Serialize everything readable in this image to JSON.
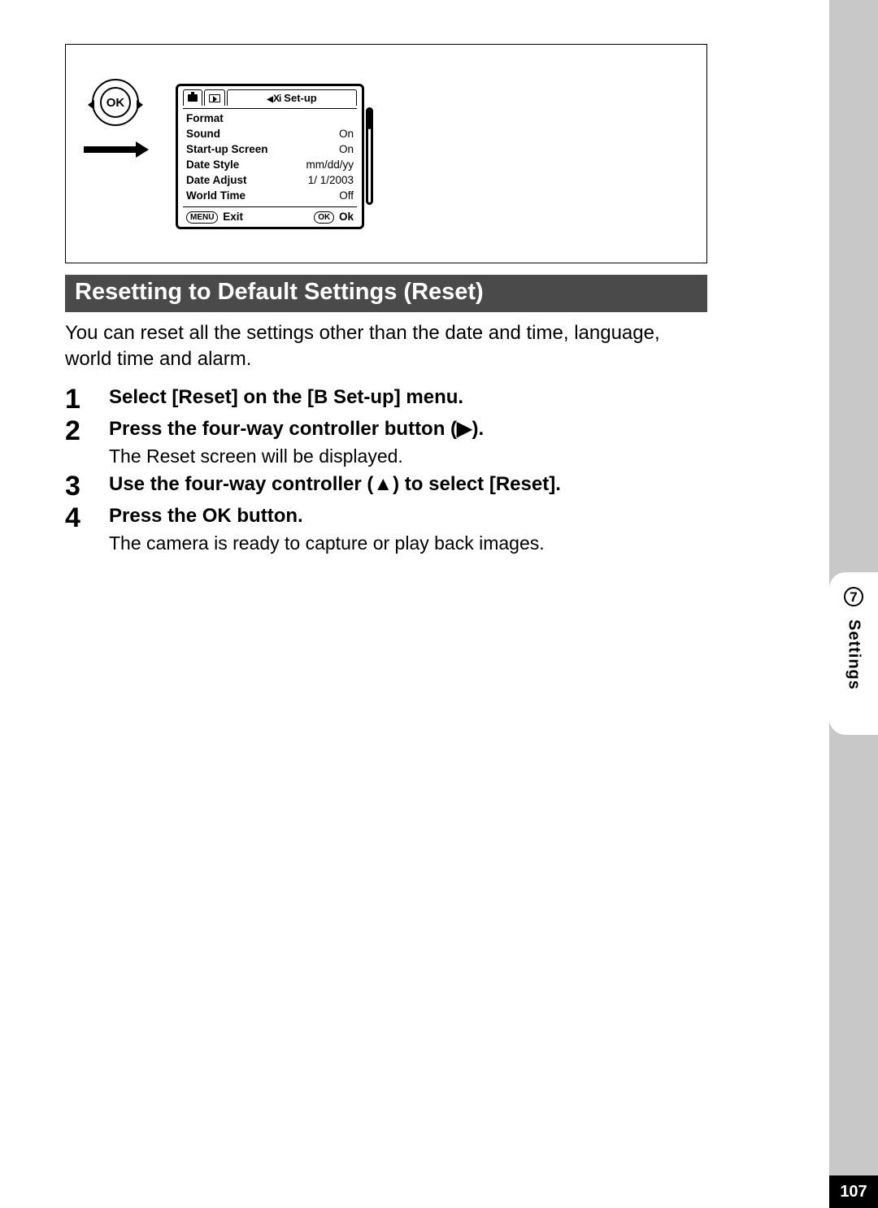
{
  "dial": {
    "label": "OK"
  },
  "lcd": {
    "active_tab_label": "Set-up",
    "tools_glyph": "Xi",
    "menu": [
      {
        "k": "Format",
        "v": ""
      },
      {
        "k": "Sound",
        "v": "On"
      },
      {
        "k": "Start-up Screen",
        "v": "On"
      },
      {
        "k": "Date Style",
        "v": "mm/dd/yy"
      },
      {
        "k": "Date Adjust",
        "v": "1/ 1/2003"
      },
      {
        "k": "World Time",
        "v": "Off"
      }
    ],
    "footer": {
      "left_btn": "MENU",
      "left_label": "Exit",
      "right_btn": "OK",
      "right_label": "Ok"
    }
  },
  "heading": "Resetting to Default Settings (Reset)",
  "intro": "You can reset all the settings other than the date and time, language, world time and alarm.",
  "steps": [
    {
      "num": "1",
      "title_pre": "Select [Reset] on the [",
      "title_icon": "B",
      "title_post": " Set-up] menu."
    },
    {
      "num": "2",
      "title": "Press the four-way controller button (▶).",
      "desc": "The Reset screen will be displayed."
    },
    {
      "num": "3",
      "title": "Use the four-way controller (▲) to select [Reset]."
    },
    {
      "num": "4",
      "title": "Press the OK button.",
      "desc": "The camera is ready to capture or play back images."
    }
  ],
  "side": {
    "chapter_num": "7",
    "label": "Settings"
  },
  "page_number": "107"
}
